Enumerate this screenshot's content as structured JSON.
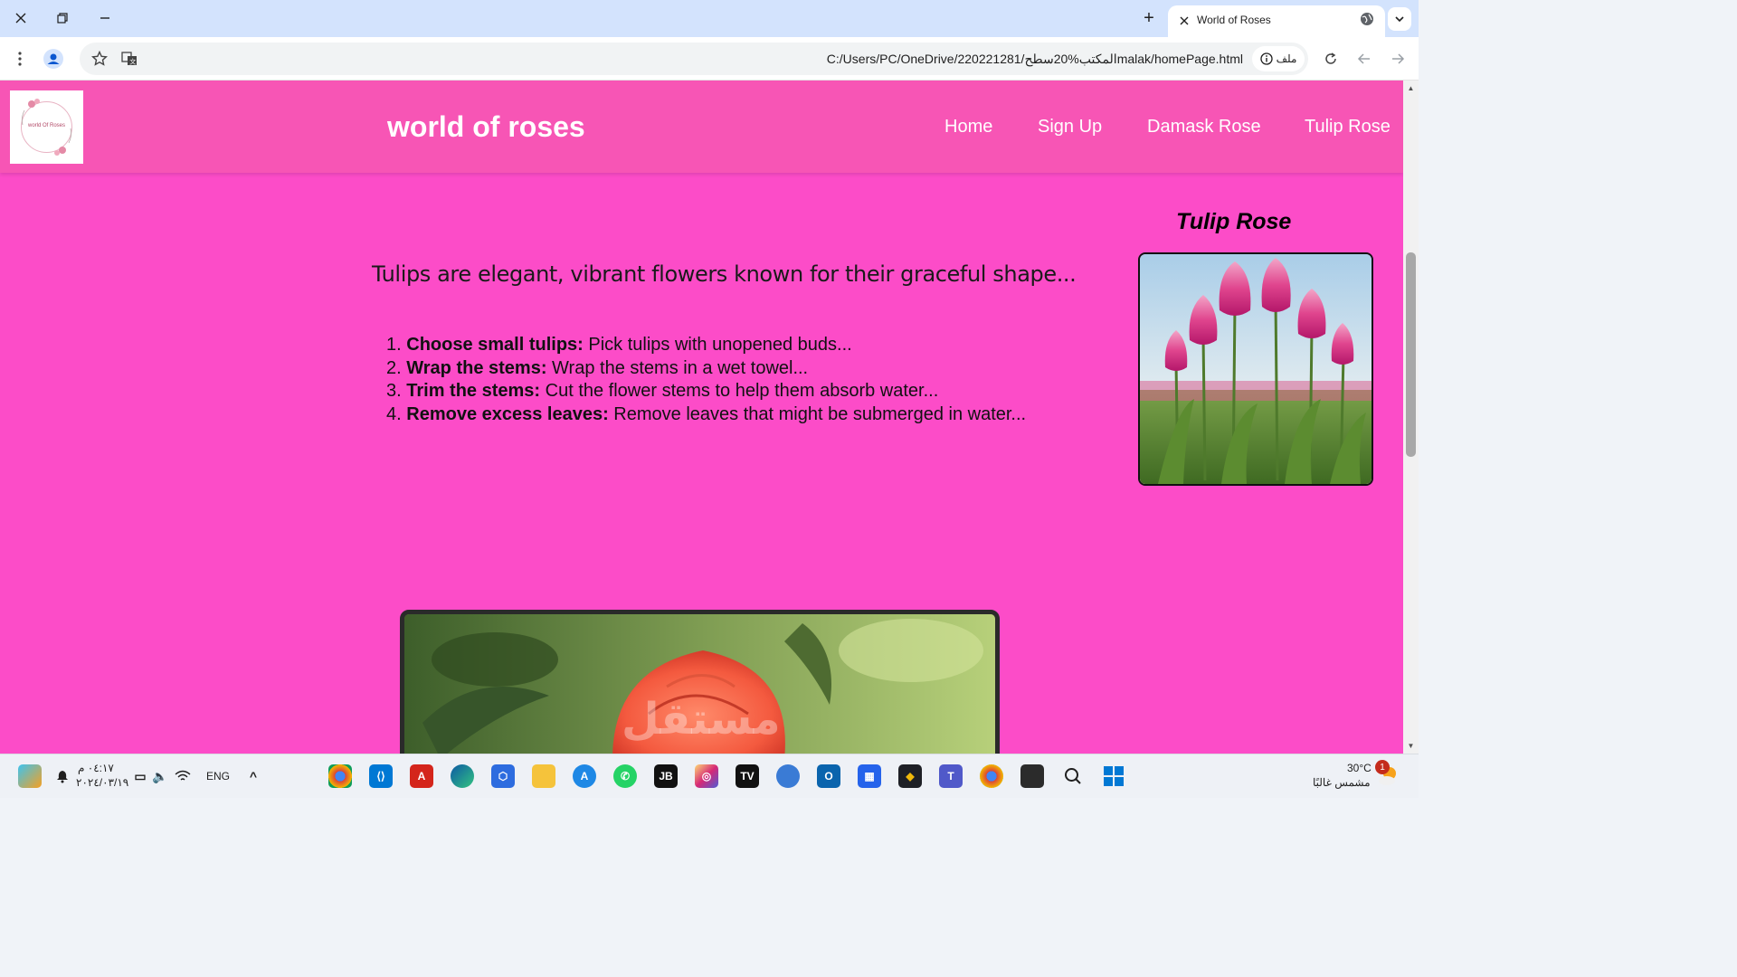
{
  "browser": {
    "tab_title": "World of Roses",
    "url": "C:/Users/PC/OneDrive/220221281/المكتب%20سطحmalak/homePage.html",
    "file_label": "ملف",
    "new_tab_symbol": "+",
    "icons": [
      "close-icon",
      "restore-icon",
      "minimize-icon",
      "new-tab-icon",
      "globe-icon",
      "chevron-down-icon",
      "menu-icon",
      "profile-icon",
      "star-icon",
      "translate-icon",
      "info-icon",
      "reload-icon",
      "back-icon",
      "forward-icon"
    ]
  },
  "site": {
    "title": "world of roses",
    "logo_text": "world Of Roses",
    "nav": [
      {
        "label": "Home"
      },
      {
        "label": "Sign Up"
      },
      {
        "label": "Damask Rose"
      },
      {
        "label": "Tulip Rose"
      }
    ],
    "side_title": "Tulip Rose",
    "intro": "Tulips are elegant, vibrant flowers known for their graceful shape...",
    "steps": [
      {
        "num": "1.",
        "bold": "Choose small tulips:",
        "text": " Pick tulips with unopened buds..."
      },
      {
        "num": "2.",
        "bold": "Wrap the stems:",
        "text": " Wrap the stems in a wet towel..."
      },
      {
        "num": "3.",
        "bold": "Trim the stems:",
        "text": " Cut the flower stems to help them absorb water..."
      },
      {
        "num": "4.",
        "bold": "Remove excess leaves:",
        "text": " Remove leaves that might be submerged in water..."
      }
    ],
    "watermark": "مستقل"
  },
  "taskbar": {
    "time": "٠٤:١٧ م",
    "date": "٢٠٢٤/٠٣/١٩",
    "lang": "ENG",
    "temperature": "30°C",
    "weather": "مشمس غالبًا",
    "notification_count": "1",
    "apps": [
      "chrome",
      "vscode",
      "acrobat",
      "edge",
      "box",
      "file-explorer",
      "app-store",
      "whatsapp",
      "jetbrains",
      "instagram",
      "tradingview",
      "globe",
      "outlook",
      "ms-store",
      "binance",
      "teams",
      "chrome-2",
      "terminal",
      "search",
      "windows-start"
    ]
  },
  "colors": {
    "page_bg": "#fc4cc8",
    "header_bg": "#f755b5",
    "titlebar": "#d3e3fd"
  }
}
